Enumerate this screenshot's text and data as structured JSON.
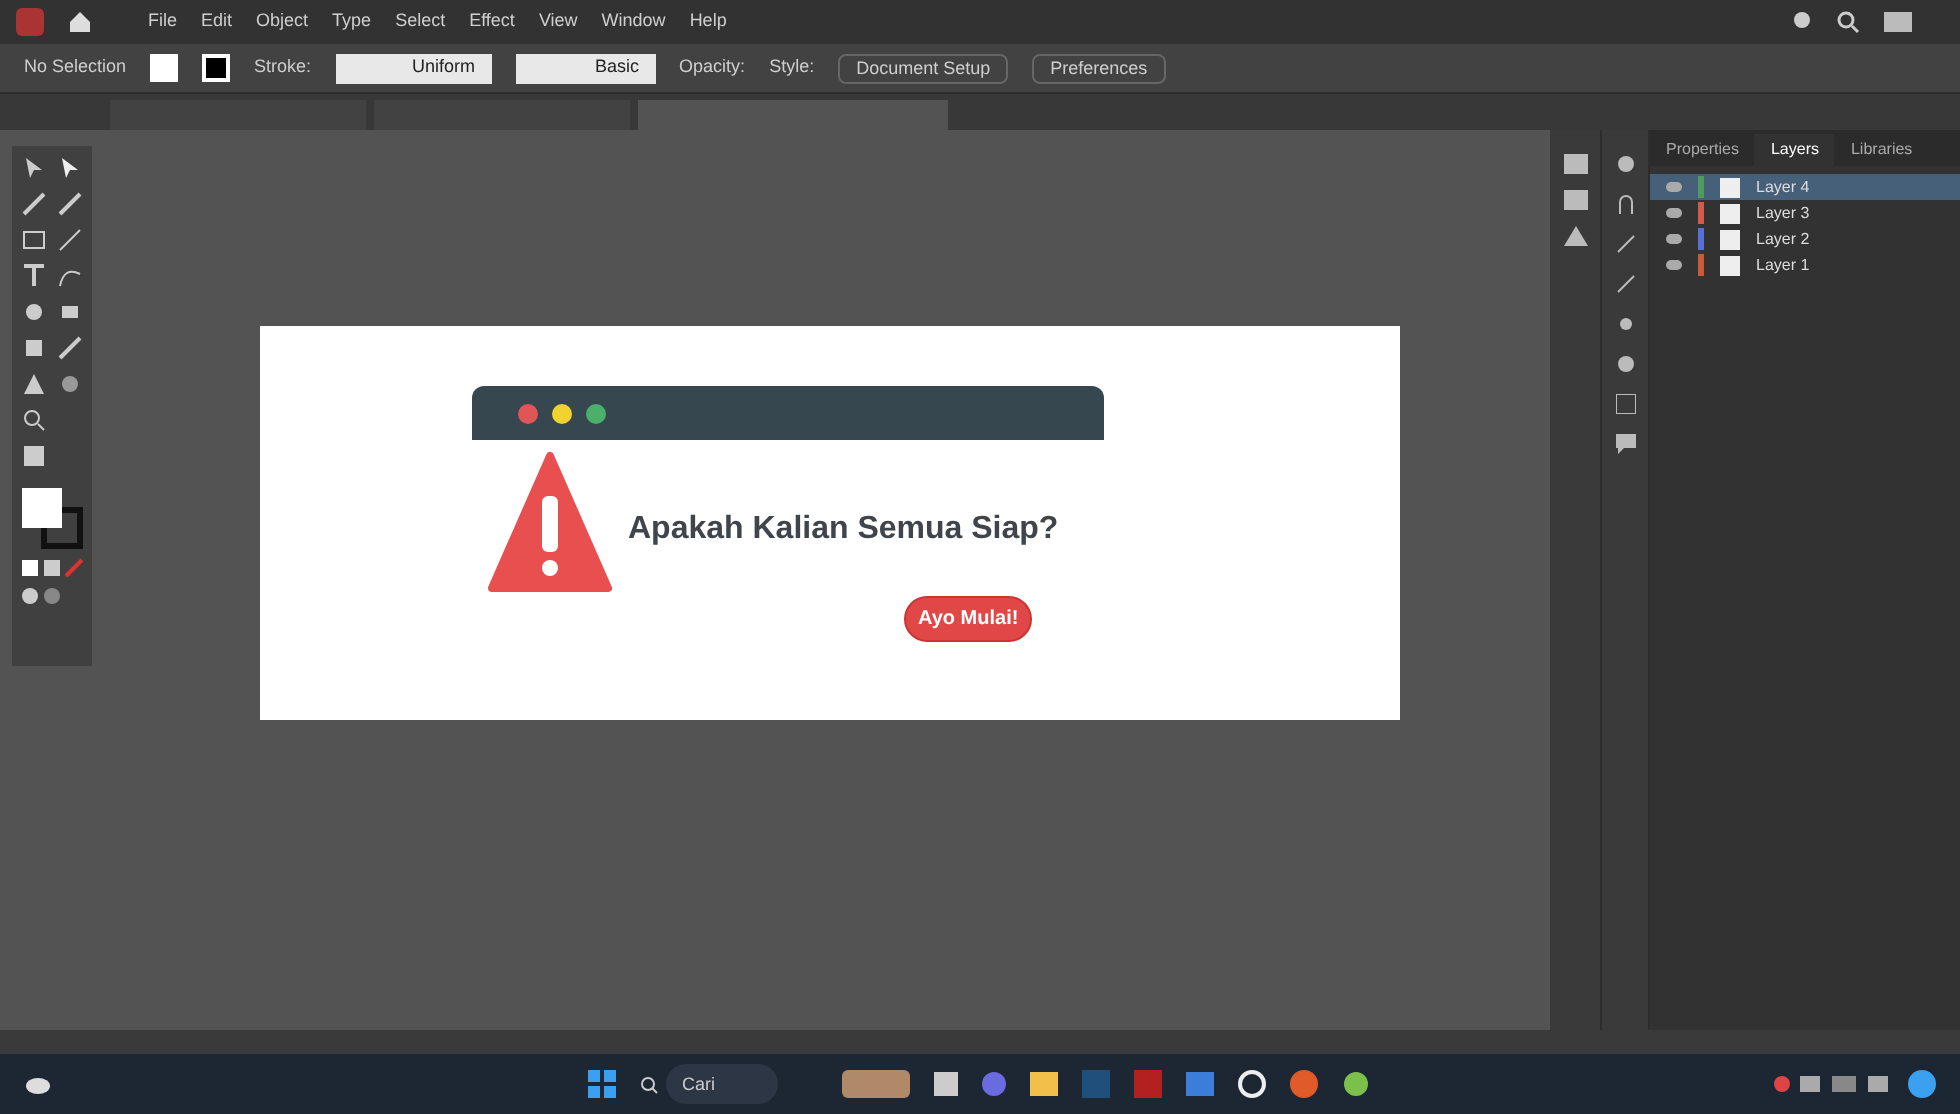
{
  "menu": [
    "File",
    "Edit",
    "Object",
    "Type",
    "Select",
    "Effect",
    "View",
    "Window",
    "Help"
  ],
  "control_bar": {
    "selection": "No Selection",
    "stroke_label": "Stroke:",
    "profile": "Uniform",
    "brush": "Basic",
    "opacity_label": "Opacity:",
    "style_label": "Style:",
    "buttons": [
      "Document Setup",
      "Preferences"
    ]
  },
  "document_tabs": [
    {
      "selected": false
    },
    {
      "selected": false
    },
    {
      "selected": true
    }
  ],
  "artboard": {
    "message": "Apakah Kalian Semua Siap?",
    "button": "Ayo Mulai!"
  },
  "panel": {
    "tabs": [
      {
        "label": "Properties",
        "selected": false
      },
      {
        "label": "Layers",
        "selected": true
      },
      {
        "label": "Libraries",
        "selected": false
      }
    ],
    "layers": [
      {
        "name": "Layer 4",
        "selected": true,
        "color": "#4f9a5f"
      },
      {
        "name": "Layer 3",
        "selected": false,
        "color": "#d65a4a"
      },
      {
        "name": "Layer 2",
        "selected": false,
        "color": "#5a6fd6"
      },
      {
        "name": "Layer 1",
        "selected": false,
        "color": "#c85a3a"
      }
    ]
  },
  "taskbar": {
    "search_placeholder": "Cari"
  }
}
